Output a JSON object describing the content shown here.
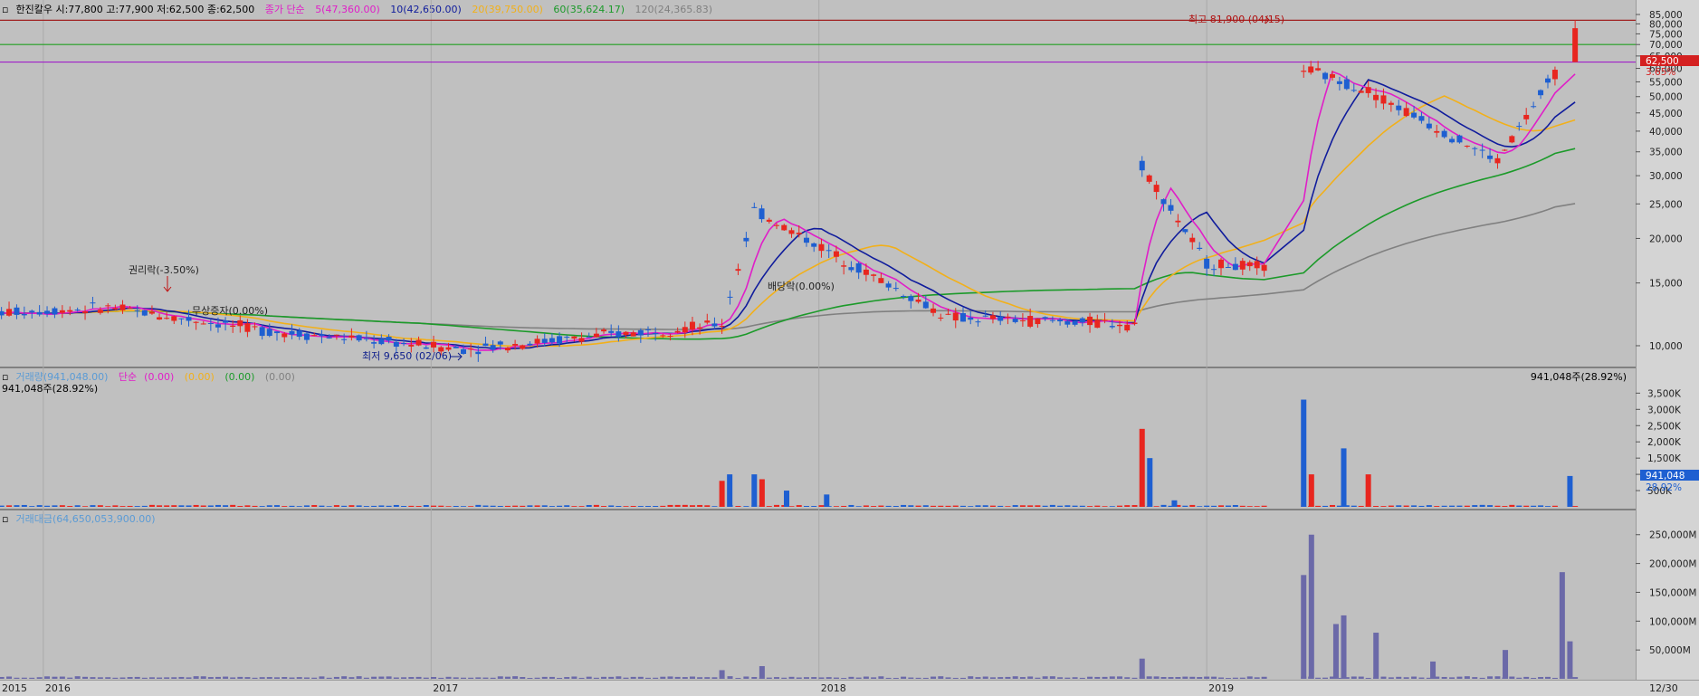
{
  "header": {
    "stock_info": "한진칼우 시:77,800 고:77,900 저:62,500 종:62,500",
    "ma_label": "종가 단순",
    "ma5": "5(47,360.00)",
    "ma10": "10(42,650.00)",
    "ma20": "20(39,750.00)",
    "ma60": "60(35,624.17)",
    "ma120": "120(24,365.83)"
  },
  "volume_panel": {
    "legend_name": "거래량(941,048.00)",
    "legend_ma_label": "단순",
    "legend_ma1": "(0.00)",
    "legend_ma2": "(0.00)",
    "legend_ma3": "(0.00)",
    "legend_ma4": "(0.00)",
    "sub_legend": "941,048주(28.92%)",
    "right_note": "941,048주(28.92%)",
    "current_tag": "941,048",
    "percent_tag": "28.92%"
  },
  "amount_panel": {
    "legend_name": "거래대금(64,650,053,900.00)"
  },
  "price_tags": {
    "current": "62,500",
    "change": "3.65%"
  },
  "annotations": {
    "high": "최고 81,900 (04/15)",
    "low": "최저 9,650 (02/06)",
    "rights": "권리락(-3.50%)",
    "capital": "무상증자(0.00%)",
    "dividend": "배당락(0.00%)"
  },
  "colors": {
    "up": "#e8261f",
    "down": "#1e5fd1",
    "ma5": "#e01ec8",
    "ma10": "#101c9c",
    "ma20": "#f2b01a",
    "ma60": "#1c9a2a",
    "ma120": "#808080",
    "amount": "#6b69a8"
  },
  "chart_data": [
    {
      "type": "candlestick",
      "title": "한진칼우 (weekly)",
      "y_scale": "log",
      "ylim": [
        9000,
        86000
      ],
      "y_ticks": [
        "85,000",
        "80,000",
        "75,000",
        "70,000",
        "65,000",
        "60,000",
        "55,000",
        "50,000",
        "45,000",
        "40,000",
        "35,000",
        "30,000",
        "25,000",
        "20,000",
        "15,000",
        "10,000"
      ],
      "x_labels": [
        "2015",
        "2016",
        "2017",
        "2018",
        "2019",
        "12/30"
      ],
      "segments": [
        {
          "from": "2015-11",
          "to": "2016-03",
          "level_start": 12300,
          "level_end": 12800
        },
        {
          "from": "2016-03",
          "to": "2016-08",
          "level_start": 12800,
          "level_end": 11000
        },
        {
          "from": "2016-08",
          "to": "2017-02",
          "level_start": 11000,
          "level_end": 9800
        },
        {
          "from": "2017-02",
          "to": "2017-10",
          "level_start": 9800,
          "level_end": 11500
        },
        {
          "from": "2017-10",
          "to": "2017-11",
          "level_start": 11500,
          "level_end": 24000
        },
        {
          "from": "2017-11",
          "to": "2018-05",
          "level_start": 24000,
          "level_end": 12000
        },
        {
          "from": "2018-05",
          "to": "2018-11",
          "level_start": 12000,
          "level_end": 11500
        },
        {
          "from": "2018-11",
          "to": "2019-01",
          "level_start": 32000,
          "level_end": 17000
        },
        {
          "from": "2019-01",
          "to": "2019-03",
          "level_start": 17000,
          "level_end": 16500
        },
        {
          "from": "2019-04",
          "to": "2019-06",
          "level_start": 60000,
          "level_end": 52000
        },
        {
          "from": "2019-06",
          "to": "2019-10",
          "level_start": 52000,
          "level_end": 33000
        },
        {
          "from": "2019-10",
          "to": "2019-12",
          "level_start": 33000,
          "level_end": 62500
        }
      ],
      "reference_lines": [
        81900,
        70000,
        62500
      ],
      "moving_averages": [
        "5",
        "10",
        "20",
        "60",
        "120"
      ]
    },
    {
      "type": "bar",
      "title": "거래량",
      "y_ticks": [
        "3,500K",
        "3,000K",
        "2,500K",
        "2,000K",
        "1,500K",
        "1,000K",
        "500K"
      ],
      "ylim": [
        0,
        3900000
      ],
      "values_k": [
        800,
        1000,
        1000,
        850,
        500,
        380,
        2400,
        1500,
        200,
        1000,
        3300,
        1800,
        1000,
        950
      ],
      "dates": [
        "2017-10",
        "2017-10",
        "2017-11",
        "2017-11",
        "2017-12",
        "2018-01",
        "2018-11",
        "2018-11",
        "2018-12",
        "2019-04",
        "2019-04",
        "2019-05",
        "2019-06",
        "2019-12"
      ]
    },
    {
      "type": "bar",
      "title": "거래대금",
      "y_ticks": [
        "250,000M",
        "200,000M",
        "150,000M",
        "100,000M",
        "50,000M"
      ],
      "ylim": [
        0,
        270000
      ],
      "values_m": [
        15000,
        22000,
        35000,
        250000,
        180000,
        110000,
        95000,
        80000,
        30000,
        50000,
        185000,
        65000
      ],
      "dates": [
        "2017-10",
        "2017-11",
        "2018-11",
        "2019-04",
        "2019-04",
        "2019-05",
        "2019-05",
        "2019-06",
        "2019-08",
        "2019-10",
        "2019-12",
        "2019-12"
      ]
    }
  ]
}
